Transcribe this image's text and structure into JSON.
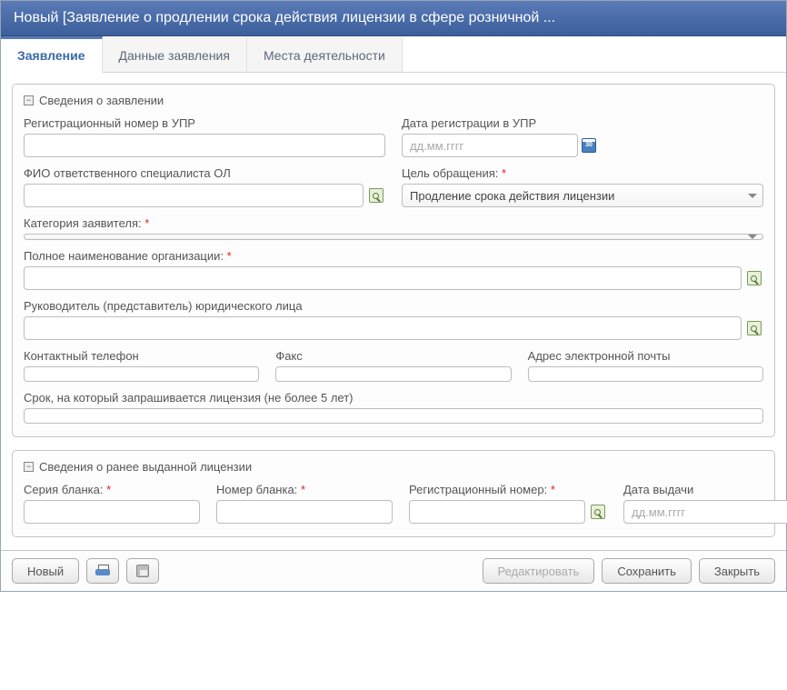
{
  "window": {
    "title": "Новый [Заявление о продлении срока действия лицензии в сфере розничной ..."
  },
  "tabs": [
    {
      "label": "Заявление",
      "active": true
    },
    {
      "label": "Данные заявления",
      "active": false
    },
    {
      "label": "Места деятельности",
      "active": false
    }
  ],
  "section_application": {
    "legend": "Сведения о заявлении",
    "reg_number_upr_label": "Регистрационный номер в УПР",
    "reg_number_upr_value": "",
    "reg_date_upr_label": "Дата регистрации в УПР",
    "reg_date_upr_placeholder": "дд.мм.гггг",
    "fio_label": "ФИО ответственного специалиста ОЛ",
    "fio_value": "",
    "purpose_label": "Цель обращения:",
    "purpose_value": "Продление срока действия лицензии",
    "category_label": "Категория заявителя:",
    "category_value": "",
    "org_full_name_label": "Полное наименование организации:",
    "org_full_name_value": "",
    "director_label": "Руководитель (представитель) юридического лица",
    "director_value": "",
    "phone_label": "Контактный телефон",
    "phone_value": "",
    "fax_label": "Факс",
    "fax_value": "",
    "email_label": "Адрес электронной почты",
    "email_value": "",
    "term_label": "Срок, на который запрашивается лицензия (не более 5 лет)",
    "term_value": ""
  },
  "section_prev_license": {
    "legend": "Сведения о ранее выданной лицензии",
    "series_label": "Серия бланка:",
    "series_value": "",
    "number_label": "Номер бланка:",
    "number_value": "",
    "reg_number_label": "Регистрационный номер:",
    "reg_number_value": "",
    "issue_date_label": "Дата выдачи",
    "issue_date_placeholder": "дд.мм.гггг"
  },
  "footer": {
    "new": "Новый",
    "edit": "Редактировать",
    "save": "Сохранить",
    "close": "Закрыть"
  }
}
